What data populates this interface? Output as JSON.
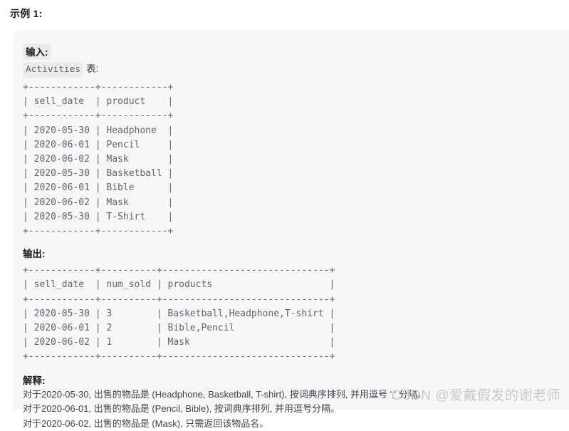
{
  "page": {
    "title": "示例 1:",
    "watermark": "CSDN @爱戴假发的谢老师"
  },
  "input_section": {
    "label": "输入:",
    "table_name": "Activities",
    "table_suffix": "表:",
    "ascii": "+------------+------------+\n| sell_date  | product    |\n+------------+------------+\n| 2020-05-30 | Headphone  |\n| 2020-06-01 | Pencil     |\n| 2020-06-02 | Mask       |\n| 2020-05-30 | Basketball |\n| 2020-06-01 | Bible      |\n| 2020-06-02 | Mask       |\n| 2020-05-30 | T-Shirt    |\n+------------+------------+"
  },
  "output_section": {
    "label": "输出:",
    "ascii": "+------------+----------+------------------------------+\n| sell_date  | num_sold | products                     |\n+------------+----------+------------------------------+\n| 2020-05-30 | 3        | Basketball,Headphone,T-shirt |\n| 2020-06-01 | 2        | Bible,Pencil                 |\n| 2020-06-02 | 1        | Mask                         |\n+------------+----------+------------------------------+"
  },
  "explanation_section": {
    "label": "解释:",
    "lines": [
      "对于2020-05-30, 出售的物品是 (Headphone, Basketball, T-shirt), 按词典序排列, 并用逗号 ',' 分隔。",
      "对于2020-06-01, 出售的物品是 (Pencil, Bible), 按词典序排列, 并用逗号分隔。",
      "对于2020-06-02, 出售的物品是 (Mask), 只需返回该物品名。"
    ]
  },
  "input_table": {
    "columns": [
      "sell_date",
      "product"
    ],
    "rows": [
      [
        "2020-05-30",
        "Headphone"
      ],
      [
        "2020-06-01",
        "Pencil"
      ],
      [
        "2020-06-02",
        "Mask"
      ],
      [
        "2020-05-30",
        "Basketball"
      ],
      [
        "2020-06-01",
        "Bible"
      ],
      [
        "2020-06-02",
        "Mask"
      ],
      [
        "2020-05-30",
        "T-Shirt"
      ]
    ]
  },
  "output_table": {
    "columns": [
      "sell_date",
      "num_sold",
      "products"
    ],
    "rows": [
      [
        "2020-05-30",
        "3",
        "Basketball,Headphone,T-shirt"
      ],
      [
        "2020-06-01",
        "2",
        "Bible,Pencil"
      ],
      [
        "2020-06-02",
        "1",
        "Mask"
      ]
    ]
  }
}
